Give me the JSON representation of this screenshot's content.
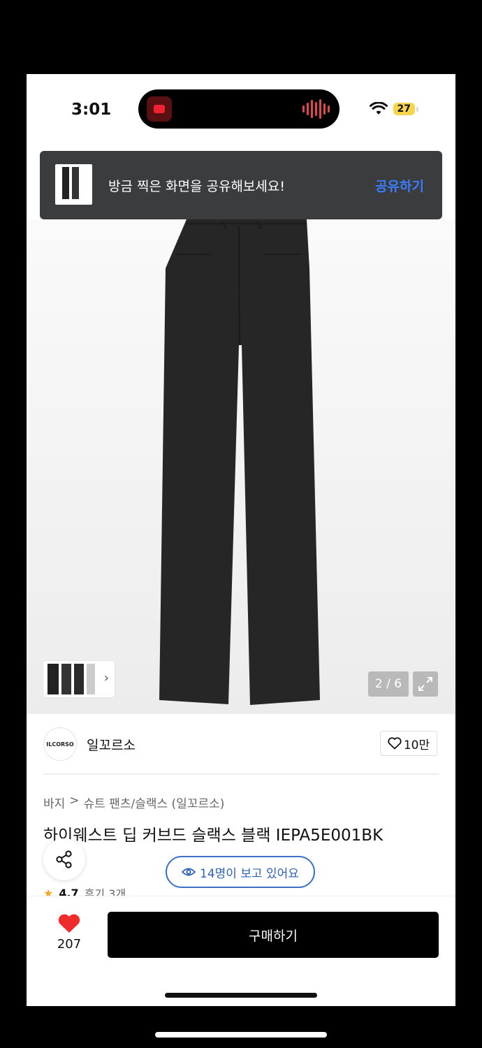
{
  "status_bar": {
    "time": "3:01",
    "battery": "27",
    "wifi_icon": "wifi-icon"
  },
  "toast": {
    "message": "방금 찍은 화면을 공유해보세요!",
    "action": "공유하기",
    "action_color": "#3b7cff"
  },
  "gallery": {
    "counter": "2 / 6",
    "expand_icon": "expand-icon"
  },
  "brand": {
    "logo_text": "ILCORSO",
    "name": "일꼬르소",
    "likes": "10만"
  },
  "breadcrumb": {
    "root": "바지",
    "separator": ">",
    "category": "슈트 팬츠/슬랙스 (일꼬르소)"
  },
  "product": {
    "title": "하이웨스트 딥 커브드 슬랙스 블랙 IEPA5E001BK",
    "viewers": "14명이 보고 있어요",
    "rating": "4.7",
    "reviews": "후기 3개"
  },
  "bottom_bar": {
    "heart_count": "207",
    "buy_label": "구매하기",
    "heart_color": "#ef2b2b"
  }
}
